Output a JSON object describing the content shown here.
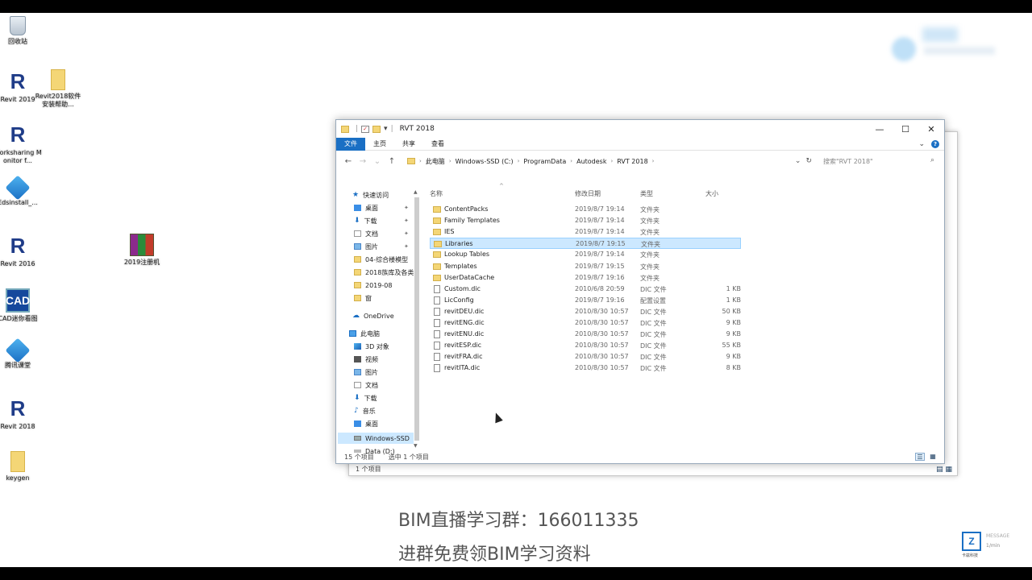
{
  "desktop_icons": [
    {
      "label": "回收站",
      "kind": "recycle"
    },
    {
      "label": "Revit 2019",
      "kind": "revit"
    },
    {
      "label": "Revit2018软件安装帮助...",
      "kind": "folder"
    },
    {
      "label": "Worksharing Monitor f...",
      "kind": "revit-wm"
    },
    {
      "label": "Edsinstall_...",
      "kind": "blue"
    },
    {
      "label": "Revit 2016",
      "kind": "revit"
    },
    {
      "label": "2019注册机",
      "kind": "winrar"
    },
    {
      "label": "CAD迷你看图",
      "kind": "cad"
    },
    {
      "label": "腾讯课堂",
      "kind": "blue"
    },
    {
      "label": "Revit 2018",
      "kind": "revit"
    },
    {
      "label": "keygen",
      "kind": "folder"
    }
  ],
  "window": {
    "title": "RVT 2018",
    "controls": {
      "minimize": "—",
      "maximize": "☐",
      "close": "✕"
    },
    "ribbon_tabs": [
      "文件",
      "主页",
      "共享",
      "查看"
    ],
    "breadcrumb": [
      "此电脑",
      "Windows-SSD (C:)",
      "ProgramData",
      "Autodesk",
      "RVT 2018"
    ],
    "search_placeholder": "搜索\"RVT 2018\"",
    "nav_pane": [
      {
        "label": "快速访问",
        "icon": "star-icon",
        "pinned": false
      },
      {
        "label": "桌面",
        "icon": "desktop-icon",
        "pinned": true
      },
      {
        "label": "下载",
        "icon": "download-icon",
        "pinned": true
      },
      {
        "label": "文档",
        "icon": "document-icon",
        "pinned": true
      },
      {
        "label": "图片",
        "icon": "picture-icon",
        "pinned": true
      },
      {
        "label": "04-综合楼模型",
        "icon": "folder-icon",
        "pinned": false
      },
      {
        "label": "2018族库及各类",
        "icon": "folder-icon",
        "pinned": false
      },
      {
        "label": "2019-08",
        "icon": "folder-icon",
        "pinned": false
      },
      {
        "label": "窗",
        "icon": "folder-icon",
        "pinned": false
      },
      {
        "label": "OneDrive",
        "icon": "cloud-icon",
        "pinned": false
      },
      {
        "label": "此电脑",
        "icon": "computer-icon",
        "pinned": false
      },
      {
        "label": "3D 对象",
        "icon": "3d-objects-icon",
        "pinned": false
      },
      {
        "label": "视频",
        "icon": "video-icon",
        "pinned": false
      },
      {
        "label": "图片",
        "icon": "picture-icon",
        "pinned": false
      },
      {
        "label": "文档",
        "icon": "document-icon",
        "pinned": false
      },
      {
        "label": "下载",
        "icon": "download-icon",
        "pinned": false
      },
      {
        "label": "音乐",
        "icon": "music-icon",
        "pinned": false
      },
      {
        "label": "桌面",
        "icon": "desktop-icon",
        "pinned": false
      },
      {
        "label": "Windows-SSD",
        "icon": "drive-icon",
        "pinned": false,
        "selected": true
      },
      {
        "label": "Data (D:)",
        "icon": "drive-icon",
        "pinned": false
      }
    ],
    "columns": {
      "name": "名称",
      "date": "修改日期",
      "type": "类型",
      "size": "大小"
    },
    "files": [
      {
        "name": "ContentPacks",
        "date": "2019/8/7 19:14",
        "type": "文件夹",
        "size": "",
        "kind": "folder"
      },
      {
        "name": "Family Templates",
        "date": "2019/8/7 19:14",
        "type": "文件夹",
        "size": "",
        "kind": "folder"
      },
      {
        "name": "IES",
        "date": "2019/8/7 19:14",
        "type": "文件夹",
        "size": "",
        "kind": "folder"
      },
      {
        "name": "Libraries",
        "date": "2019/8/7 19:15",
        "type": "文件夹",
        "size": "",
        "kind": "folder",
        "selected": true
      },
      {
        "name": "Lookup Tables",
        "date": "2019/8/7 19:14",
        "type": "文件夹",
        "size": "",
        "kind": "folder"
      },
      {
        "name": "Templates",
        "date": "2019/8/7 19:15",
        "type": "文件夹",
        "size": "",
        "kind": "folder"
      },
      {
        "name": "UserDataCache",
        "date": "2019/8/7 19:16",
        "type": "文件夹",
        "size": "",
        "kind": "folder"
      },
      {
        "name": "Custom.dic",
        "date": "2010/6/8 20:59",
        "type": "DIC 文件",
        "size": "1 KB",
        "kind": "file"
      },
      {
        "name": "LicConfig",
        "date": "2019/8/7 19:16",
        "type": "配置设置",
        "size": "1 KB",
        "kind": "cfg"
      },
      {
        "name": "revitDEU.dic",
        "date": "2010/8/30 10:57",
        "type": "DIC 文件",
        "size": "50 KB",
        "kind": "file"
      },
      {
        "name": "revitENG.dic",
        "date": "2010/8/30 10:57",
        "type": "DIC 文件",
        "size": "9 KB",
        "kind": "file"
      },
      {
        "name": "revitENU.dic",
        "date": "2010/8/30 10:57",
        "type": "DIC 文件",
        "size": "9 KB",
        "kind": "file"
      },
      {
        "name": "revitESP.dic",
        "date": "2010/8/30 10:57",
        "type": "DIC 文件",
        "size": "55 KB",
        "kind": "file"
      },
      {
        "name": "revitFRA.dic",
        "date": "2010/8/30 10:57",
        "type": "DIC 文件",
        "size": "9 KB",
        "kind": "file"
      },
      {
        "name": "revitITA.dic",
        "date": "2010/8/30 10:57",
        "type": "DIC 文件",
        "size": "8 KB",
        "kind": "file"
      }
    ],
    "status": {
      "item_count": "15 个项目",
      "selected": "选中 1 个项目"
    }
  },
  "back_window": {
    "status": "1 个项目"
  },
  "captions": {
    "line1": "BIM直播学习群：166011335",
    "line2": "进群免费领BIM学习资料"
  },
  "watermark": {
    "logo": "Z",
    "message": "MESSAGE",
    "rate": "1/min",
    "brand": "卡兹科技"
  },
  "colors": {
    "accent": "#1a6fc4",
    "selection": "#cce8ff",
    "folder": "#f4d676"
  }
}
